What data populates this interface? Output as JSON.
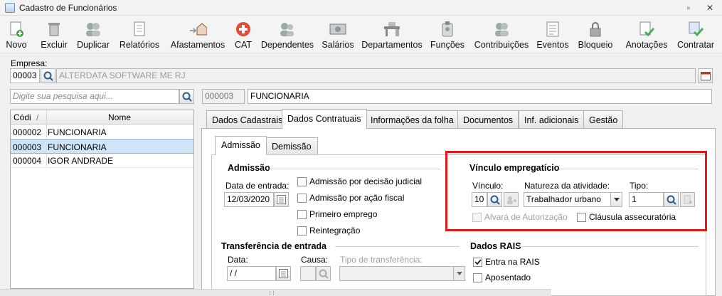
{
  "window": {
    "title": "Cadastro de Funcionários",
    "minimize": "▫",
    "close": "✕"
  },
  "toolbar": {
    "buttons": [
      {
        "label": "Novo",
        "icon": "new-icon"
      },
      {
        "label": "Excluir",
        "icon": "trash-icon"
      },
      {
        "label": "Duplicar",
        "icon": "duplicate-users-icon"
      },
      {
        "label": "Relatórios",
        "icon": "report-icon"
      },
      {
        "label": "Afastamentos",
        "icon": "house-arrow-icon"
      },
      {
        "label": "CAT",
        "icon": "medical-cross-icon"
      },
      {
        "label": "Dependentes",
        "icon": "people-icon"
      },
      {
        "label": "Salários",
        "icon": "money-icon"
      },
      {
        "label": "Departamentos",
        "icon": "desk-icon"
      },
      {
        "label": "Funções",
        "icon": "badge-icon"
      },
      {
        "label": "Contribuições",
        "icon": "people-icon"
      },
      {
        "label": "Eventos",
        "icon": "list-icon"
      },
      {
        "label": "Bloqueio",
        "icon": "lock-icon"
      },
      {
        "label": "Anotações",
        "icon": "note-check-icon"
      },
      {
        "label": "Contratar",
        "icon": "hire-check-icon"
      }
    ]
  },
  "empresa": {
    "label": "Empresa:",
    "code": "00003",
    "name": "ALTERDATA SOFTWARE ME RJ"
  },
  "search": {
    "placeholder": "Digite sua pesquisa aqui..."
  },
  "selected_employee": {
    "code": "000003",
    "name": "FUNCIONARIA"
  },
  "grid": {
    "headers": {
      "code": "Códi",
      "name": "Nome"
    },
    "rows": [
      {
        "code": "000002",
        "name": "FUNCIONARIA"
      },
      {
        "code": "000003",
        "name": "FUNCIONARIA"
      },
      {
        "code": "000004",
        "name": "IGOR ANDRADE"
      }
    ]
  },
  "tabs": [
    "Dados Cadastrais",
    "Dados Contratuais",
    "Informações da folha",
    "Documentos",
    "Inf. adicionais",
    "Gestão"
  ],
  "subtabs": [
    "Admissão",
    "Demissão"
  ],
  "admissao": {
    "title": "Admissão",
    "data_label": "Data de entrada:",
    "data_value": "12/03/2020",
    "checks": [
      "Admissão por decisão judicial",
      "Admissão por ação fiscal",
      "Primeiro emprego",
      "Reintegração"
    ]
  },
  "vinculo": {
    "title": "Vínculo empregatício",
    "vinculo_label": "Vínculo:",
    "vinculo_value": "10",
    "natureza_label": "Natureza da atividade:",
    "natureza_value": "Trabalhador urbano",
    "tipo_label": "Tipo:",
    "tipo_value": "1",
    "alvara": "Alvará de Autorização",
    "clausula": "Cláusula assecuratória"
  },
  "transferencia": {
    "title": "Transferência de entrada",
    "data_label": "Data:",
    "data_value": " / /",
    "causa_label": "Causa:",
    "tipo_label": "Tipo de transferência:"
  },
  "rais": {
    "title": "Dados RAIS",
    "entra": "Entra na RAIS",
    "aposentado": "Aposentado"
  },
  "colors": {
    "highlight_box": "#e01a1a",
    "selection": "#cfe4f6"
  }
}
